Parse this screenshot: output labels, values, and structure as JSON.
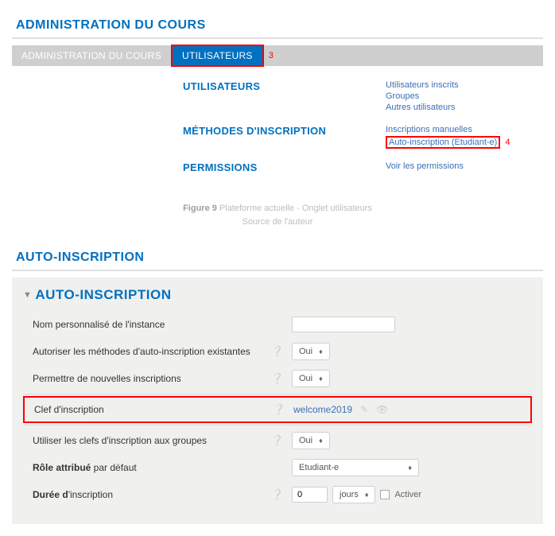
{
  "section1": {
    "title": "ADMINISTRATION DU COURS",
    "tabs": {
      "admin": "ADMINISTRATION DU COURS",
      "users": "UTILISATEURS"
    },
    "annotations": {
      "tab": "3",
      "link": "4"
    },
    "groups": {
      "users": {
        "heading": "UTILISATEURS",
        "links": {
          "enrolled": "Utilisateurs inscrits",
          "groups": "Groupes",
          "others": "Autres utilisateurs"
        }
      },
      "methods": {
        "heading": "MÉTHODES D'INSCRIPTION",
        "links": {
          "manual": "Inscriptions manuelles",
          "self": "Auto-inscription (Etudiant-e)"
        }
      },
      "perms": {
        "heading": "PERMISSIONS",
        "links": {
          "view": "Voir les permissions"
        }
      }
    }
  },
  "caption": {
    "prefix": "Figure 9",
    "line1_rest": " Plateforme actuelle - Onglet utilisateurs",
    "line2": "Source de l'auteur"
  },
  "section2": {
    "title": "AUTO-INSCRIPTION",
    "panel_title": "AUTO-INSCRIPTION",
    "fields": {
      "custom_name": {
        "label": "Nom personnalisé de l'instance",
        "value": ""
      },
      "allow_existing": {
        "label": "Autoriser les méthodes d'auto-inscription existantes",
        "value": "Oui"
      },
      "allow_new": {
        "label": "Permettre de nouvelles inscriptions",
        "value": "Oui"
      },
      "enrol_key": {
        "label": "Clef d'inscription",
        "value": "welcome2019"
      },
      "group_keys": {
        "label": "Utiliser les clefs d'inscription aux groupes",
        "value": "Oui"
      },
      "default_role": {
        "label_prefix": "Rôle attribué",
        "label_rest": " par défaut",
        "value": "Etudiant-e"
      },
      "duration": {
        "label_prefix": "Durée d",
        "label_rest": "'inscription",
        "value": "0",
        "unit": "jours",
        "activate": "Activer"
      }
    }
  }
}
